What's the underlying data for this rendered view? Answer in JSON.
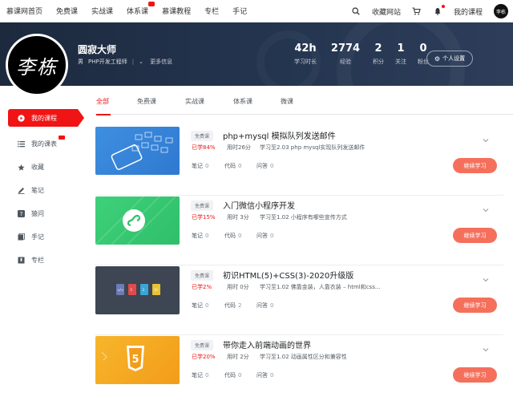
{
  "nav": {
    "items": [
      "慕课网首页",
      "免费课",
      "实战课",
      "体系课",
      "慕课教程",
      "专栏",
      "手记"
    ],
    "collect": "收藏网站",
    "my_course": "我的课程",
    "avatar_text": "李栋"
  },
  "profile": {
    "avatar_text": "李栋",
    "name": "圆寂大师",
    "gender": "男",
    "job": "PHP开发工程师",
    "more": "更多信息",
    "settings_label": "个人设置"
  },
  "stats": [
    {
      "num": "42h",
      "label": "学习时长"
    },
    {
      "num": "2774",
      "label": "经验"
    },
    {
      "num": "2",
      "label": "积分"
    },
    {
      "num": "1",
      "label": "关注"
    },
    {
      "num": "0",
      "label": "粉丝"
    }
  ],
  "sidebar": {
    "items": [
      {
        "label": "我的课程",
        "icon": "play-circle-icon"
      },
      {
        "label": "我的课表",
        "icon": "list-icon"
      },
      {
        "label": "收藏",
        "icon": "star-icon"
      },
      {
        "label": "笔记",
        "icon": "pen-icon"
      },
      {
        "label": "猿问",
        "icon": "question-icon"
      },
      {
        "label": "手记",
        "icon": "book-icon"
      },
      {
        "label": "专栏",
        "icon": "bookmark-icon"
      }
    ]
  },
  "tabs": [
    "全部",
    "免费课",
    "实战课",
    "体系课",
    "微课"
  ],
  "courses": [
    {
      "tag": "免费课",
      "title": "php+mysql 模拟队列发送邮件",
      "progress": "已学84%",
      "time": "用时26分",
      "last": "学习至2.03 php mysql实现队列发送邮件",
      "notes_label": "笔记",
      "notes": "0",
      "code_label": "代码",
      "code": "0",
      "qa_label": "问答",
      "qa": "0",
      "button": "继续学习",
      "thumb": "thumb-blue"
    },
    {
      "tag": "免费课",
      "title": "入门微信小程序开发",
      "progress": "已学15%",
      "time": "用时 3分",
      "last": "学习至1.02 小程序有哪些宣传方式",
      "notes_label": "笔记",
      "notes": "0",
      "code_label": "代码",
      "code": "0",
      "qa_label": "问答",
      "qa": "0",
      "button": "继续学习",
      "thumb": "thumb-green"
    },
    {
      "tag": "免费课",
      "title": "初识HTML(5)+CSS(3)-2020升级版",
      "progress": "已学2%",
      "time": "用时 0分",
      "last": "学习至1.02 佛靠金装，人靠衣装 – html和css...",
      "notes_label": "笔记",
      "notes": "0",
      "code_label": "代码",
      "code": "2",
      "qa_label": "问答",
      "qa": "0",
      "button": "继续学习",
      "thumb": "thumb-dark"
    },
    {
      "tag": "免费课",
      "title": "带你走入前端动画的世界",
      "progress": "已学20%",
      "time": "用时 2分",
      "last": "学习至1.02 动画属性区分和兼容性",
      "notes_label": "笔记",
      "notes": "0",
      "code_label": "代码",
      "code": "0",
      "qa_label": "问答",
      "qa": "0",
      "button": "继续学习",
      "thumb": "thumb-orange"
    }
  ],
  "colors": {
    "accent": "#f01414",
    "button": "#f5705c",
    "banner": "#243550"
  }
}
